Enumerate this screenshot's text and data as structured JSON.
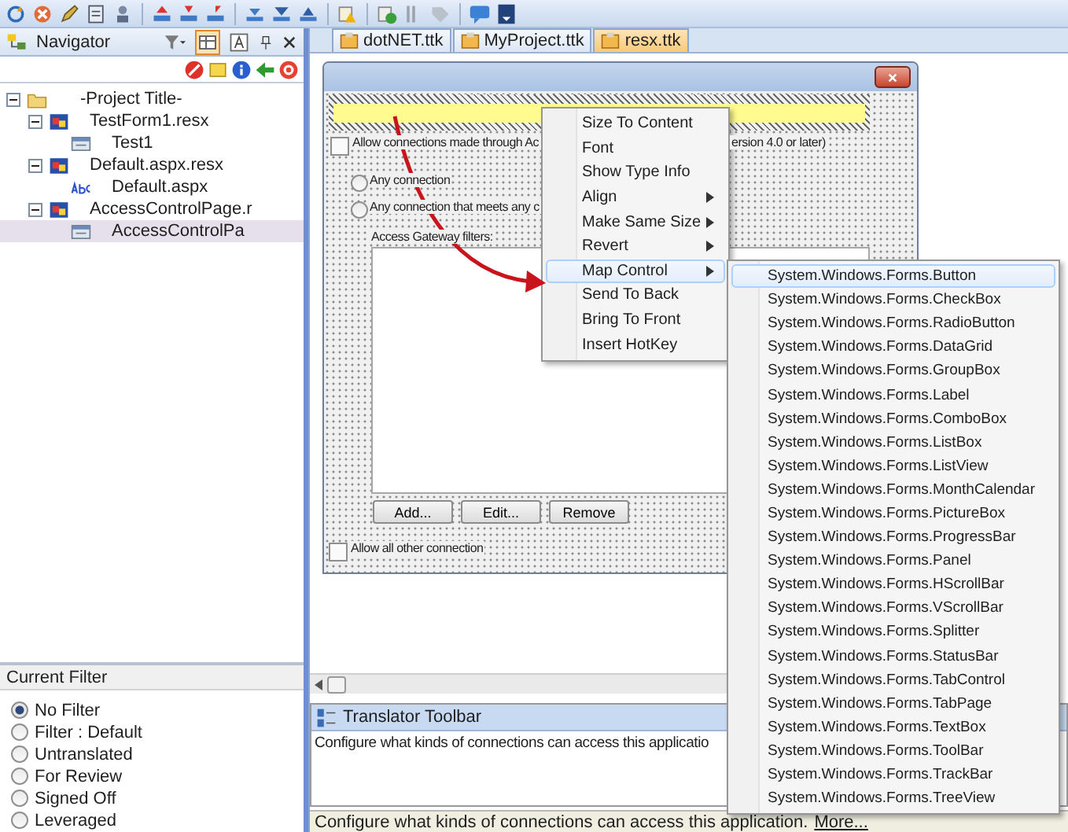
{
  "navigator": {
    "title": "Navigator",
    "tree": [
      {
        "label": "-Project Title-",
        "kind": "folder",
        "expanded": true,
        "selected": false,
        "children": [
          {
            "label": "TestForm1.resx",
            "kind": "form",
            "expanded": true,
            "selected": false,
            "children": [
              {
                "label": "Test1",
                "kind": "dialog",
                "selected": false
              }
            ]
          },
          {
            "label": "Default.aspx.resx",
            "kind": "form",
            "expanded": true,
            "selected": false,
            "children": [
              {
                "label": "Default.aspx",
                "kind": "text",
                "selected": false
              }
            ]
          },
          {
            "label": "AccessControlPage.r",
            "kind": "form",
            "expanded": true,
            "selected": false,
            "children": [
              {
                "label": "AccessControlPa",
                "kind": "dialog",
                "selected": true
              }
            ]
          }
        ]
      }
    ]
  },
  "current_filter": {
    "title": "Current Filter",
    "options": [
      {
        "label": "No Filter",
        "selected": true
      },
      {
        "label": "Filter : Default",
        "selected": false
      },
      {
        "label": "Untranslated",
        "selected": false
      },
      {
        "label": "For Review",
        "selected": false
      },
      {
        "label": "Signed Off",
        "selected": false
      },
      {
        "label": "Leveraged",
        "selected": false
      }
    ]
  },
  "tabs": [
    {
      "label": "dotNET.ttk",
      "selected": false
    },
    {
      "label": "MyProject.ttk",
      "selected": false
    },
    {
      "label": "resx.ttk",
      "selected": true
    }
  ],
  "form": {
    "top_checkbox": {
      "label": "Allow connections made through Ac",
      "label_end": "ersion 4.0 or later)",
      "checked": false
    },
    "radios": [
      {
        "label": "Any connection",
        "selected": false
      },
      {
        "label": "Any connection that meets any c",
        "selected": false
      }
    ],
    "filters_label": "Access Gateway filters:",
    "buttons": [
      "Add...",
      "Edit...",
      "Remove"
    ],
    "bottom_checkbox": {
      "label": "Allow all  other connection",
      "checked": false
    }
  },
  "context_menu": {
    "items": [
      {
        "label": "Size To Content",
        "submenu": false,
        "selected": false
      },
      {
        "label": "Font",
        "submenu": false,
        "selected": false
      },
      {
        "label": "Show Type Info",
        "submenu": false,
        "selected": false
      },
      {
        "label": "Align",
        "submenu": true,
        "selected": false
      },
      {
        "label": "Make Same Size",
        "submenu": true,
        "selected": false
      },
      {
        "label": "Revert",
        "submenu": true,
        "selected": false
      },
      {
        "label": "Map Control",
        "submenu": true,
        "selected": true
      },
      {
        "label": "Send To Back",
        "submenu": false,
        "selected": false
      },
      {
        "label": "Bring To Front",
        "submenu": false,
        "selected": false
      },
      {
        "label": "Insert HotKey",
        "submenu": false,
        "selected": false
      }
    ]
  },
  "submenu": {
    "items": [
      {
        "label": "System.Windows.Forms.Button",
        "selected": true
      },
      {
        "label": "System.Windows.Forms.CheckBox",
        "selected": false
      },
      {
        "label": "System.Windows.Forms.RadioButton",
        "selected": false
      },
      {
        "label": "System.Windows.Forms.DataGrid",
        "selected": false
      },
      {
        "label": "System.Windows.Forms.GroupBox",
        "selected": false
      },
      {
        "label": "System.Windows.Forms.Label",
        "selected": false
      },
      {
        "label": "System.Windows.Forms.ComboBox",
        "selected": false
      },
      {
        "label": "System.Windows.Forms.ListBox",
        "selected": false
      },
      {
        "label": "System.Windows.Forms.ListView",
        "selected": false
      },
      {
        "label": "System.Windows.Forms.MonthCalendar",
        "selected": false
      },
      {
        "label": "System.Windows.Forms.PictureBox",
        "selected": false
      },
      {
        "label": "System.Windows.Forms.ProgressBar",
        "selected": false
      },
      {
        "label": "System.Windows.Forms.Panel",
        "selected": false
      },
      {
        "label": "System.Windows.Forms.HScrollBar",
        "selected": false
      },
      {
        "label": "System.Windows.Forms.VScrollBar",
        "selected": false
      },
      {
        "label": "System.Windows.Forms.Splitter",
        "selected": false
      },
      {
        "label": "System.Windows.Forms.StatusBar",
        "selected": false
      },
      {
        "label": "System.Windows.Forms.TabControl",
        "selected": false
      },
      {
        "label": "System.Windows.Forms.TabPage",
        "selected": false
      },
      {
        "label": "System.Windows.Forms.TextBox",
        "selected": false
      },
      {
        "label": "System.Windows.Forms.ToolBar",
        "selected": false
      },
      {
        "label": "System.Windows.Forms.TrackBar",
        "selected": false
      },
      {
        "label": "System.Windows.Forms.TreeView",
        "selected": false
      }
    ]
  },
  "translator_toolbar": {
    "title": "Translator Toolbar",
    "text": "Configure what kinds of connections can access this applicatio"
  },
  "status_bar": {
    "text": "Configure what kinds of connections can access this application.",
    "link": "More..."
  }
}
